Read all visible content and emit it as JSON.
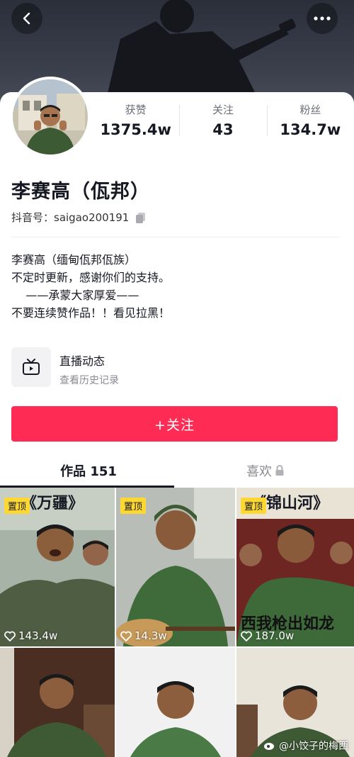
{
  "header": {
    "back_icon": "chevron-left-icon",
    "more_icon": "more-dots-icon"
  },
  "stats": [
    {
      "label": "获赞",
      "value": "1375.4w"
    },
    {
      "label": "关注",
      "value": "43"
    },
    {
      "label": "粉丝",
      "value": "134.7w"
    }
  ],
  "profile": {
    "name": "李赛高（佤邦）",
    "douyin_id": "抖音号：saigao200191",
    "copy_icon": "copy-icon"
  },
  "bio": [
    "李赛高（缅甸佤邦佤族）",
    "不定时更新，感谢你们的支持。",
    "    ——承蒙大家厚爱——",
    "不要连续赞作品！！看见拉黑！"
  ],
  "live": {
    "title": "直播动态",
    "subtitle": "查看历史记录",
    "icon": "tv-icon"
  },
  "follow_button": "+关注",
  "tabs": [
    {
      "label": "作品 151",
      "active": true
    },
    {
      "label": "喜欢",
      "active": false,
      "icon": "lock-icon"
    }
  ],
  "videos": [
    {
      "pinned": "置顶",
      "likes": "143.4w",
      "caption": "《万疆》"
    },
    {
      "pinned": "置顶",
      "likes": "14.3w",
      "caption": ""
    },
    {
      "pinned": "置顶",
      "likes": "187.0w",
      "caption": "《锦山河》",
      "overlay_text": "西我枪出如龙"
    },
    {
      "pinned": "",
      "likes": "",
      "caption": ""
    },
    {
      "pinned": "",
      "likes": "",
      "caption": ""
    },
    {
      "pinned": "",
      "likes": "",
      "caption": ""
    }
  ],
  "watermark": "@小饺子的梅西",
  "colors": {
    "accent": "#fe2c55",
    "pin": "#fdd835",
    "text": "#161823",
    "muted": "#8a8b91"
  }
}
